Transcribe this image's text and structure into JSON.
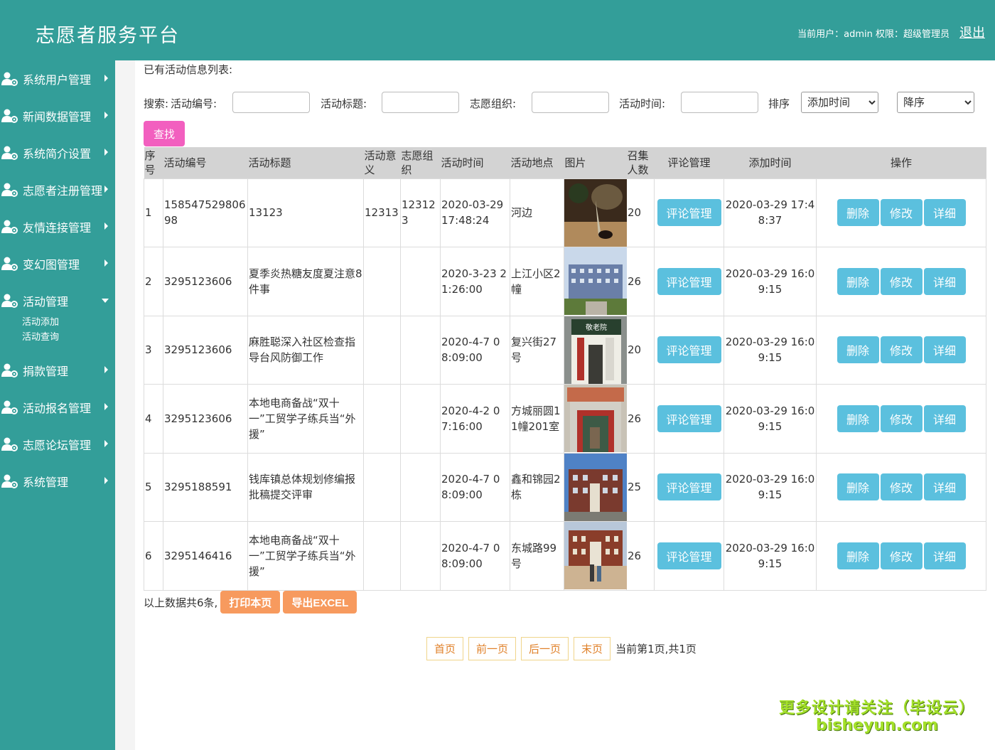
{
  "header": {
    "title": "志愿者服务平台",
    "user_info": "当前用户：admin  权限：超级管理员",
    "logout": "退出"
  },
  "sidebar": {
    "items": [
      {
        "label": "系统用户管理",
        "expanded": false
      },
      {
        "label": "新闻数据管理",
        "expanded": false
      },
      {
        "label": "系统简介设置",
        "expanded": false
      },
      {
        "label": "志愿者注册管理",
        "expanded": false
      },
      {
        "label": "友情连接管理",
        "expanded": false
      },
      {
        "label": "变幻图管理",
        "expanded": false
      },
      {
        "label": "活动管理",
        "expanded": true
      },
      {
        "label": "捐款管理",
        "expanded": false
      },
      {
        "label": "活动报名管理",
        "expanded": false
      },
      {
        "label": "志愿论坛管理",
        "expanded": false
      },
      {
        "label": "系统管理",
        "expanded": false
      }
    ],
    "sub_items": [
      "活动添加",
      "活动查询"
    ]
  },
  "main": {
    "list_title": "已有活动信息列表:",
    "search": {
      "prefix": "搜索:",
      "label_no": "活动编号:",
      "label_title": "活动标题:",
      "label_org": "志愿组织:",
      "label_time": "活动时间:",
      "label_sort": "排序",
      "sort_field": "添加时间",
      "sort_order": "降序",
      "find_button": "查找"
    },
    "table": {
      "headers": [
        "序号",
        "活动编号",
        "活动标题",
        "活动意义",
        "志愿组织",
        "活动时间",
        "活动地点",
        "图片",
        "召集人数",
        "评论管理",
        "添加时间",
        "操作"
      ],
      "rows": [
        {
          "seq": "1",
          "no": "15854752980698",
          "title": "13123",
          "meaning": "12313",
          "org": "123123",
          "time": "2020-03-29 17:48:24",
          "place": "河边",
          "count": "20",
          "added": "2020-03-29 17:48:37"
        },
        {
          "seq": "2",
          "no": "3295123606",
          "title": "夏季炎热糖友度夏注意8件事",
          "meaning": "",
          "org": "",
          "time": "2020-3-23 21:26:00",
          "place": "上江小区2幢",
          "count": "26",
          "added": "2020-03-29 16:09:15"
        },
        {
          "seq": "3",
          "no": "3295123606",
          "title": "麻胜聪深入社区检查指导台风防御工作",
          "meaning": "",
          "org": "",
          "time": "2020-4-7 08:09:00",
          "place": "复兴街27号",
          "count": "20",
          "added": "2020-03-29 16:09:15"
        },
        {
          "seq": "4",
          "no": "3295123606",
          "title": "本地电商备战“双十一”工贸学子练兵当“外援”",
          "meaning": "",
          "org": "",
          "time": "2020-4-2 07:16:00",
          "place": "方城丽圆11幢201室",
          "count": "26",
          "added": "2020-03-29 16:09:15"
        },
        {
          "seq": "5",
          "no": "3295188591",
          "title": "钱库镇总体规划修编报批稿提交评审",
          "meaning": "",
          "org": "",
          "time": "2020-4-7 08:09:00",
          "place": "鑫和锦园2栋",
          "count": "25",
          "added": "2020-03-29 16:09:15"
        },
        {
          "seq": "6",
          "no": "3295146416",
          "title": "本地电商备战“双十一”工贸学子练兵当“外援”",
          "meaning": "",
          "org": "",
          "time": "2020-4-7 08:09:00",
          "place": "东城路99号",
          "count": "26",
          "added": "2020-03-29 16:09:15"
        }
      ],
      "comment_button": "评论管理",
      "delete_button": "删除",
      "edit_button": "修改",
      "detail_button": "详细"
    },
    "summary": "以上数据共6条,",
    "print_button": "打印本页",
    "export_button": "导出EXCEL",
    "pager": {
      "first": "首页",
      "prev": "前一页",
      "next": "后一页",
      "last": "末页",
      "info": "当前第1页,共1页"
    }
  },
  "watermark": {
    "line1": "更多设计请关注（毕设云）",
    "line2": "bisheyun.com"
  },
  "colors": {
    "primary": "#339e99",
    "button_blue": "#5bc0de",
    "button_pink": "#f25fbf",
    "button_orange": "#f79a5e"
  }
}
